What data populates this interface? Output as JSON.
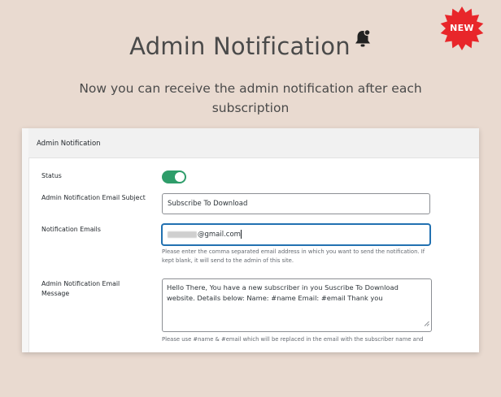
{
  "badge": {
    "label": "NEW",
    "color": "#e8262a"
  },
  "hero": {
    "title": "Admin Notification",
    "subtitle": "Now you can receive the admin notification after each subscription"
  },
  "panel": {
    "header_title": "Admin Notification",
    "status": {
      "label": "Status",
      "enabled": true,
      "color": "#2e9d6a"
    },
    "subject": {
      "label": "Admin Notification Email Subject",
      "value": "Subscribe To Download"
    },
    "emails": {
      "label": "Notification Emails",
      "value_suffix": "@gmail.com",
      "help": "Please enter the comma separated email address in which you want to send the notification. If kept blank, it will send to the admin of this site."
    },
    "message": {
      "label": "Admin Notification Email Message",
      "value": "Hello There, You have a new subscriber in you Suscribe To Download website. Details below: Name: #name Email: #email Thank you",
      "help": "Please use #name & #email which will be replaced in the email with the subscriber name and"
    }
  }
}
